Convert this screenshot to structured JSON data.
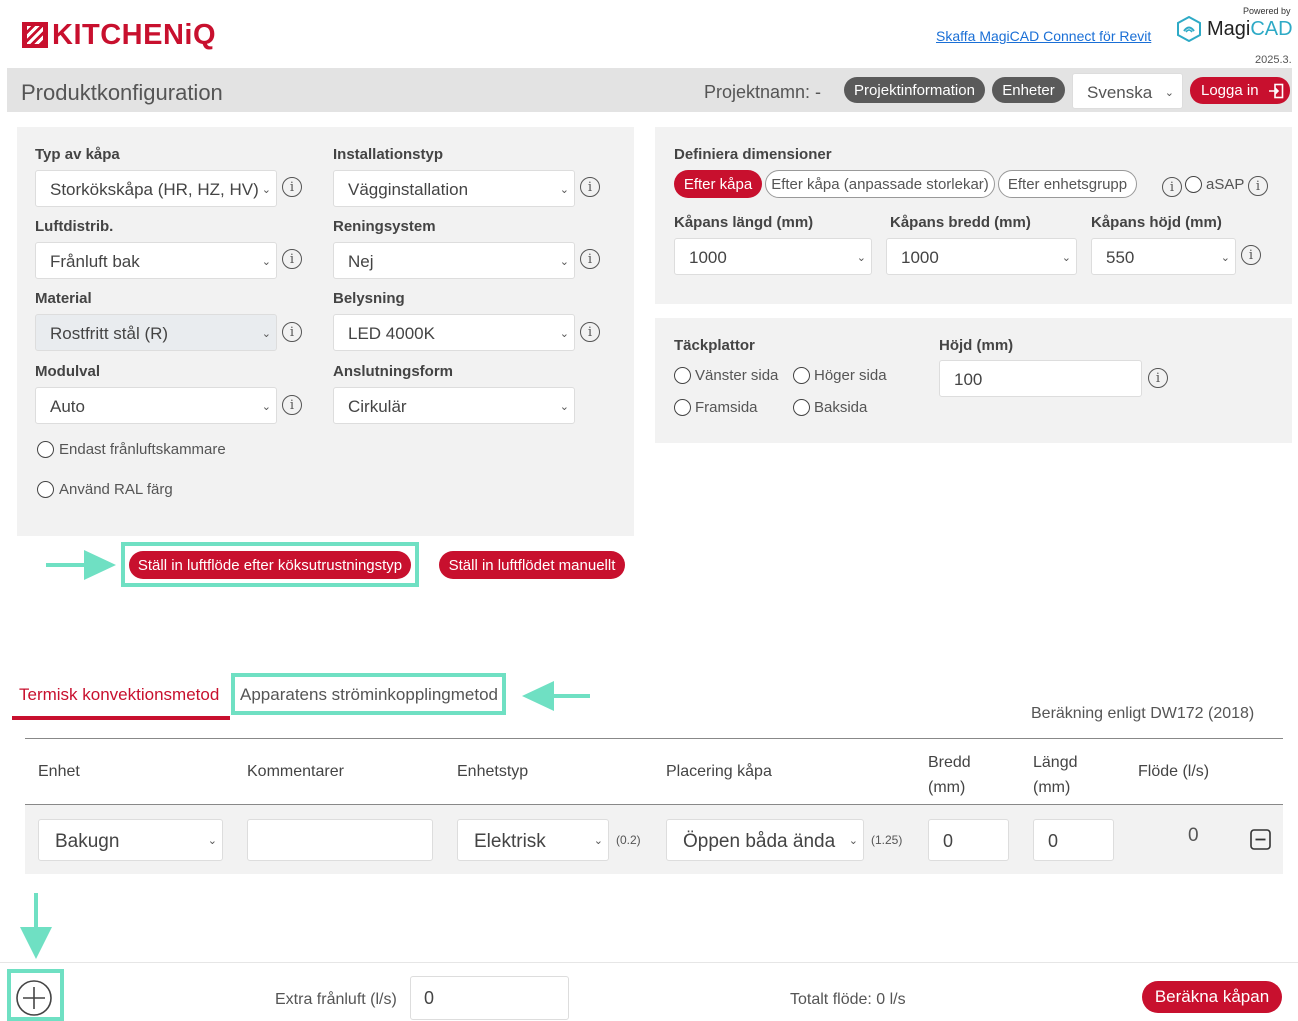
{
  "header": {
    "logo_text": "KITCHENiQ",
    "revit_link": "Skaffa MagiCAD Connect för Revit",
    "powered_by": "Powered by",
    "magicad_prefix": "Magi",
    "magicad_suffix": "CAD",
    "version": "2025.3."
  },
  "titlebar": {
    "title": "Produktkonfiguration",
    "project_name": "Projektnamn: -",
    "project_info_button": "Projektinformation",
    "units_button": "Enheter",
    "language": "Svenska",
    "login_button": "Logga in"
  },
  "left_panel": {
    "hood_type_label": "Typ av kåpa",
    "hood_type_value": "Storkökskåpa (HR, HZ, HV)",
    "installation_label": "Installationstyp",
    "installation_value": "Vägginstallation",
    "air_distribution_label": "Luftdistrib.",
    "air_distribution_value": "Frånluft bak",
    "cleaning_label": "Reningsystem",
    "cleaning_value": "Nej",
    "material_label": "Material",
    "material_value": "Rostfritt stål (R)",
    "lighting_label": "Belysning",
    "lighting_value": "LED 4000K",
    "module_label": "Modulval",
    "module_value": "Auto",
    "connection_label": "Anslutningsform",
    "connection_value": "Cirkulär",
    "exhaust_only": "Endast frånluftskammare",
    "ral_color": "Använd RAL färg"
  },
  "dimensions": {
    "title": "Definiera dimensioner",
    "tab_by_hood": "Efter kåpa",
    "tab_custom": "Efter kåpa (anpassade storlekar)",
    "tab_unit_group": "Efter enhetsgrupp",
    "asap": "aSAP",
    "length_label": "Kåpans längd (mm)",
    "length_value": "1000",
    "width_label": "Kåpans bredd (mm)",
    "width_value": "1000",
    "height_label": "Kåpans höjd (mm)",
    "height_value": "550"
  },
  "cover_plates": {
    "title": "Täckplattor",
    "left": "Vänster sida",
    "right": "Höger sida",
    "front": "Framsida",
    "back": "Baksida",
    "height_label": "Höjd (mm)",
    "height_value": "100"
  },
  "airflow_buttons": {
    "by_equipment": "Ställ in luftflöde efter köksutrustningstyp",
    "manual": "Ställ in luftflödet manuellt"
  },
  "method_tabs": {
    "thermal": "Termisk konvektionsmetod",
    "power": "Apparatens ströminkopplingmetod",
    "calc_note": "Beräkning enligt DW172 (2018)"
  },
  "table": {
    "headers": [
      "Enhet",
      "Kommentarer",
      "Enhetstyp",
      "Placering kåpa",
      "Bredd (mm)",
      "Längd (mm)",
      "Flöde (l/s)"
    ],
    "row": {
      "unit": "Bakugn",
      "comment": "",
      "unit_type": "Elektrisk",
      "unit_type_factor": "(0.2)",
      "placement": "Öppen båda ända",
      "placement_factor": "(1.25)",
      "width": "0",
      "length": "0",
      "flow": "0"
    }
  },
  "footer": {
    "extra_exhaust_label": "Extra frånluft (l/s)",
    "extra_exhaust_value": "0",
    "total_flow": "Totalt flöde: 0 l/s",
    "calculate_button": "Beräkna kåpan"
  },
  "colors": {
    "brand_red": "#c8102e",
    "annotation_teal": "#6fe0c3",
    "link_blue": "#1a6fd6"
  }
}
